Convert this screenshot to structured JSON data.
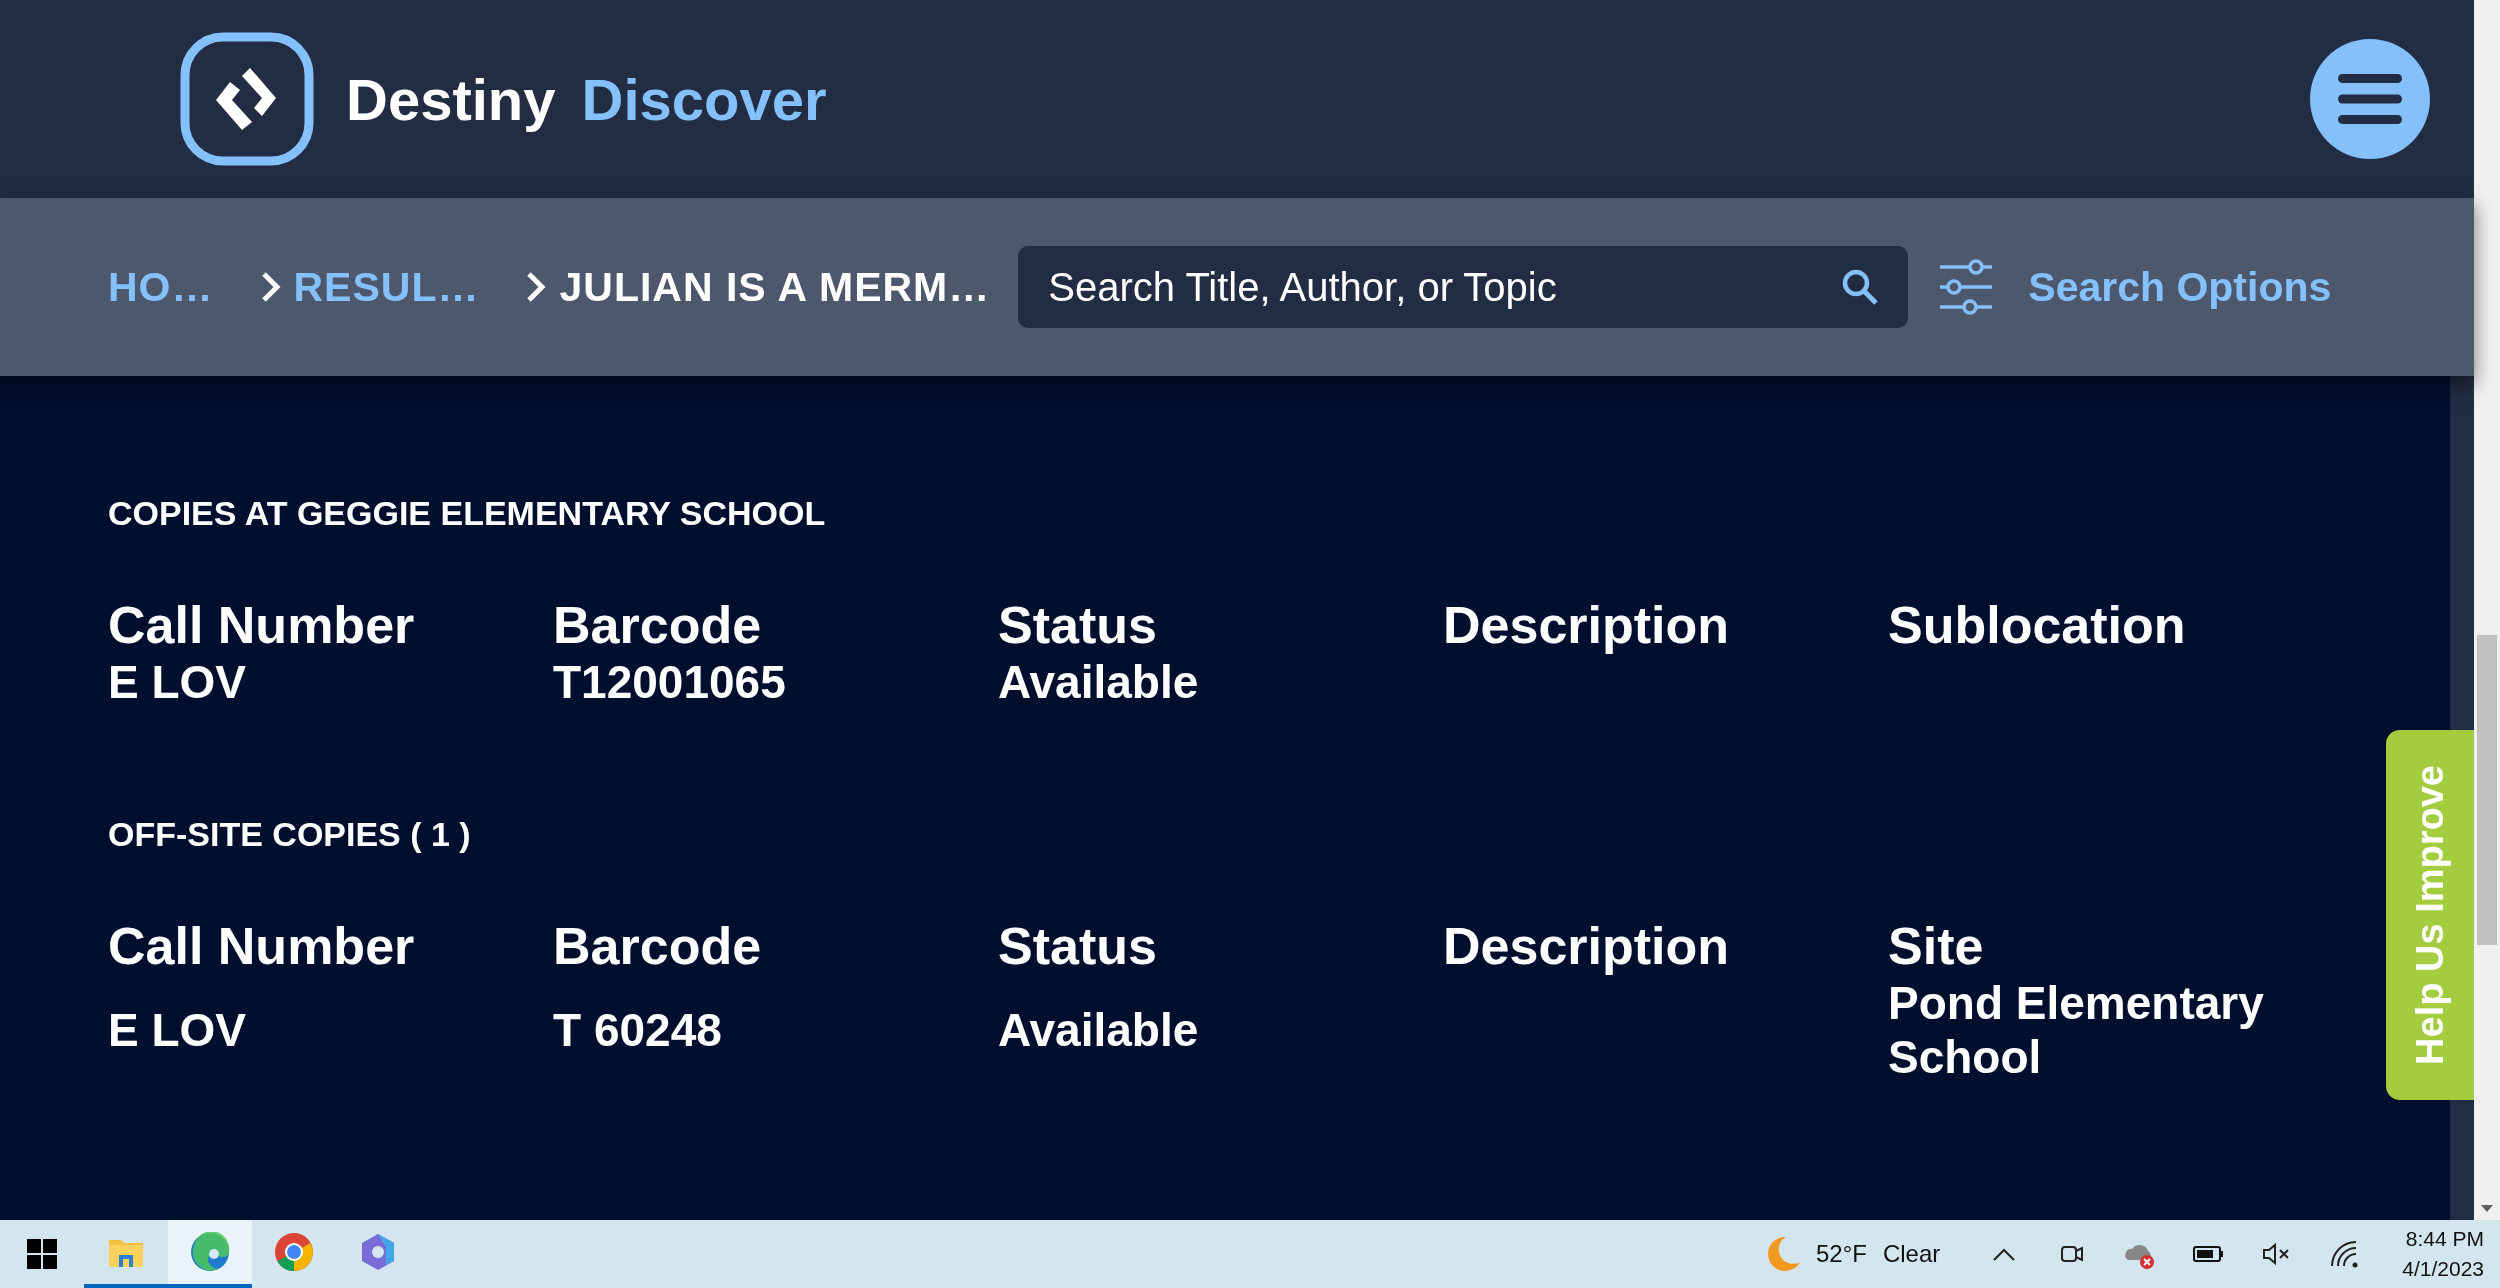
{
  "header": {
    "logo_first": "Destiny",
    "logo_second": "Discover"
  },
  "breadcrumbs": [
    {
      "label": "HO…",
      "kind": "link"
    },
    {
      "label": "RESUL…",
      "kind": "link"
    },
    {
      "label": "JULIAN IS A MERM…",
      "kind": "current"
    }
  ],
  "search": {
    "placeholder": "Search Title, Author, or Topic"
  },
  "search_options": "Search Options",
  "sections": [
    {
      "heading": "COPIES AT GEGGIE ELEMENTARY SCHOOL",
      "columns": [
        {
          "header": "Call Number",
          "value": "E LOV"
        },
        {
          "header": "Barcode",
          "value": "T12001065"
        },
        {
          "header": "Status",
          "value": "Available"
        },
        {
          "header": "Description"
        },
        {
          "header": "Sublocation"
        }
      ]
    },
    {
      "heading": "OFF-SITE COPIES ( 1 )",
      "columns": [
        {
          "header": "Call Number",
          "value": "E LOV"
        },
        {
          "header": "Barcode",
          "value": "T 60248"
        },
        {
          "header": "Status",
          "value": "Available"
        },
        {
          "header": "Description"
        },
        {
          "header": "Site",
          "value": "Pond Elementary School"
        }
      ]
    }
  ],
  "feedback_tab": "Help Us Improve",
  "taskbar": {
    "apps": [
      {
        "kind": "explorer",
        "running": true,
        "selected": false
      },
      {
        "kind": "edge",
        "running": true,
        "selected": true
      },
      {
        "kind": "chrome",
        "running": false,
        "selected": false
      },
      {
        "kind": "office",
        "running": false,
        "selected": false
      }
    ],
    "weather": {
      "temperature": "52°F",
      "condition": "Clear"
    },
    "clock": {
      "time": "8:44 PM",
      "date": "4/1/2023"
    }
  }
}
